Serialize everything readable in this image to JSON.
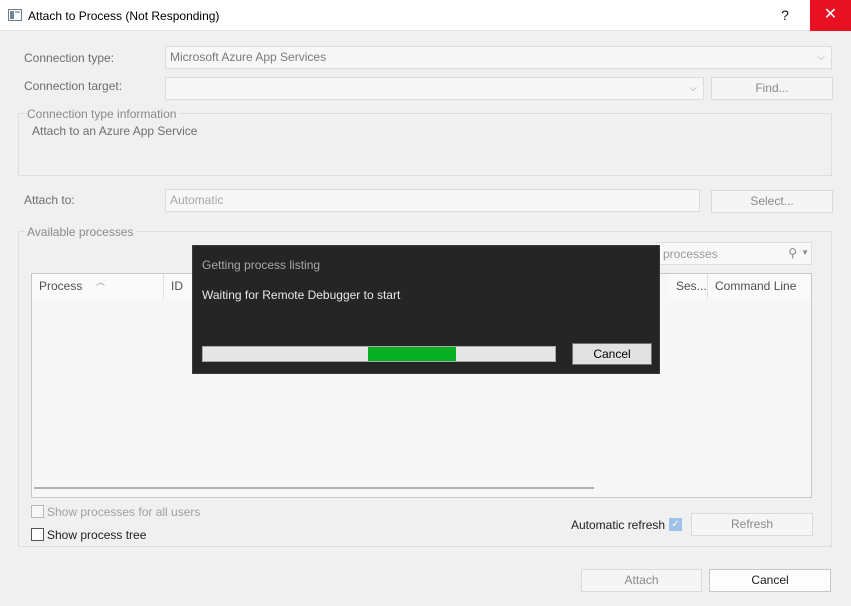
{
  "window": {
    "title": "Attach to Process (Not Responding)",
    "help": "?",
    "close": "✕"
  },
  "connection_type": {
    "label": "Connection type:",
    "value": "Microsoft Azure App Services"
  },
  "connection_target": {
    "label": "Connection target:",
    "value": "",
    "find_label": "Find..."
  },
  "info": {
    "title": "Connection type information",
    "text": "Attach to an Azure App Service"
  },
  "attach_to": {
    "label": "Attach to:",
    "value": "Automatic",
    "select_label": "Select..."
  },
  "processes": {
    "title": "Available processes",
    "filter_placeholder": "processes",
    "columns": [
      "Process",
      "ID",
      "Ses...",
      "Command Line"
    ]
  },
  "options": {
    "all_users": "Show processes for all users",
    "process_tree": "Show process tree",
    "auto_refresh": "Automatic refresh",
    "refresh_label": "Refresh"
  },
  "footer": {
    "attach": "Attach",
    "cancel": "Cancel"
  },
  "progress_dialog": {
    "title": "Getting process listing",
    "message": "Waiting for Remote Debugger to start",
    "cancel": "Cancel",
    "progress": {
      "start_fraction": 0.47,
      "end_fraction": 0.72
    }
  },
  "colors": {
    "close_button": "#e81123",
    "progress_fill": "#06b025",
    "overlay_bg": "#252526"
  }
}
